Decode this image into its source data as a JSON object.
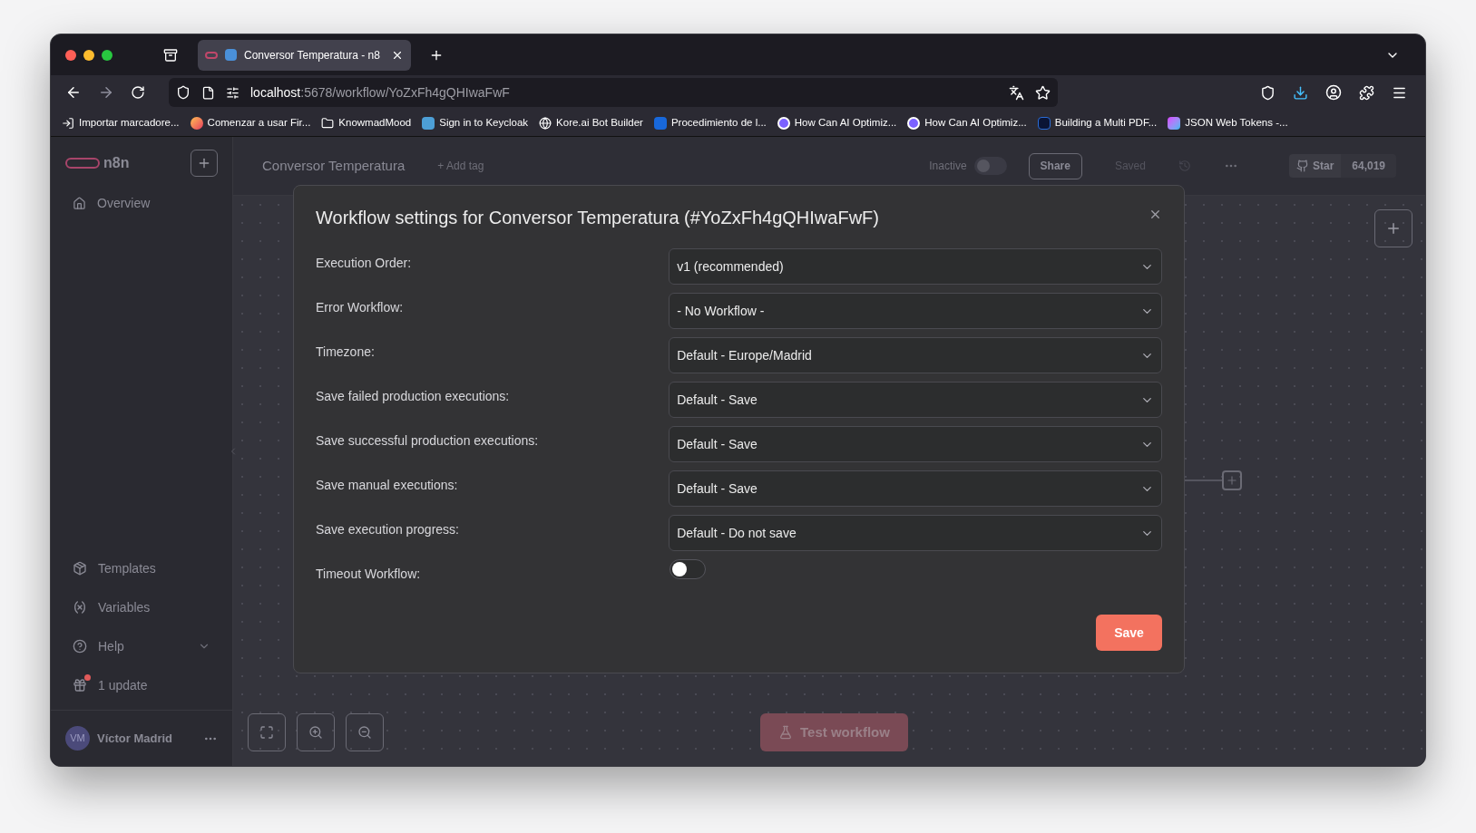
{
  "browser": {
    "tabs": [
      {
        "title": "Conversor Temperatura - n8",
        "selected": true
      }
    ],
    "url": {
      "host": "localhost",
      "path": ":5678/workflow/YoZxFh4gQHIwaFwF"
    },
    "bookmarks": [
      {
        "label": "Importar marcadore..."
      },
      {
        "label": "Comenzar a usar Fir..."
      },
      {
        "label": "KnowmadMood"
      },
      {
        "label": "Sign in to Keycloak"
      },
      {
        "label": "Kore.ai Bot Builder"
      },
      {
        "label": "Procedimiento de l..."
      },
      {
        "label": "How Can AI Optimiz..."
      },
      {
        "label": "How Can AI Optimiz..."
      },
      {
        "label": "Building a Multi PDF..."
      },
      {
        "label": "JSON Web Tokens -..."
      }
    ]
  },
  "app": {
    "logo": "n8n",
    "sidebar_top": [
      {
        "label": "Overview"
      }
    ],
    "sidebar_bottom": [
      {
        "label": "Templates",
        "expandable": false,
        "badge": false
      },
      {
        "label": "Variables",
        "expandable": false,
        "badge": false
      },
      {
        "label": "Help",
        "expandable": true,
        "badge": false
      },
      {
        "label": "1 update",
        "expandable": false,
        "badge": true
      }
    ],
    "user": {
      "initials": "VM",
      "name": "Víctor Madrid"
    },
    "header": {
      "workflow_name": "Conversor Temperatura",
      "add_tag": "+ Add tag",
      "status_label": "Inactive",
      "active": false,
      "share": "Share",
      "saved": "Saved",
      "star": "Star",
      "star_count": "64,019"
    },
    "canvas": {
      "test_button": "Test workflow"
    }
  },
  "modal": {
    "title": "Workflow settings for Conversor Temperatura (#YoZxFh4gQHIwaFwF)",
    "fields": [
      {
        "label": "Execution Order:",
        "kind": "select",
        "value": "v1 (recommended)"
      },
      {
        "label": "Error Workflow:",
        "kind": "select",
        "value": "- No Workflow -"
      },
      {
        "label": "Timezone:",
        "kind": "select",
        "value": "Default - Europe/Madrid"
      },
      {
        "label": "Save failed production executions:",
        "kind": "select",
        "value": "Default - Save"
      },
      {
        "label": "Save successful production executions:",
        "kind": "select",
        "value": "Default - Save"
      },
      {
        "label": "Save manual executions:",
        "kind": "select",
        "value": "Default - Save"
      },
      {
        "label": "Save execution progress:",
        "kind": "select",
        "value": "Default - Do not save"
      },
      {
        "label": "Timeout Workflow:",
        "kind": "toggle",
        "on": false
      }
    ],
    "save": "Save"
  }
}
